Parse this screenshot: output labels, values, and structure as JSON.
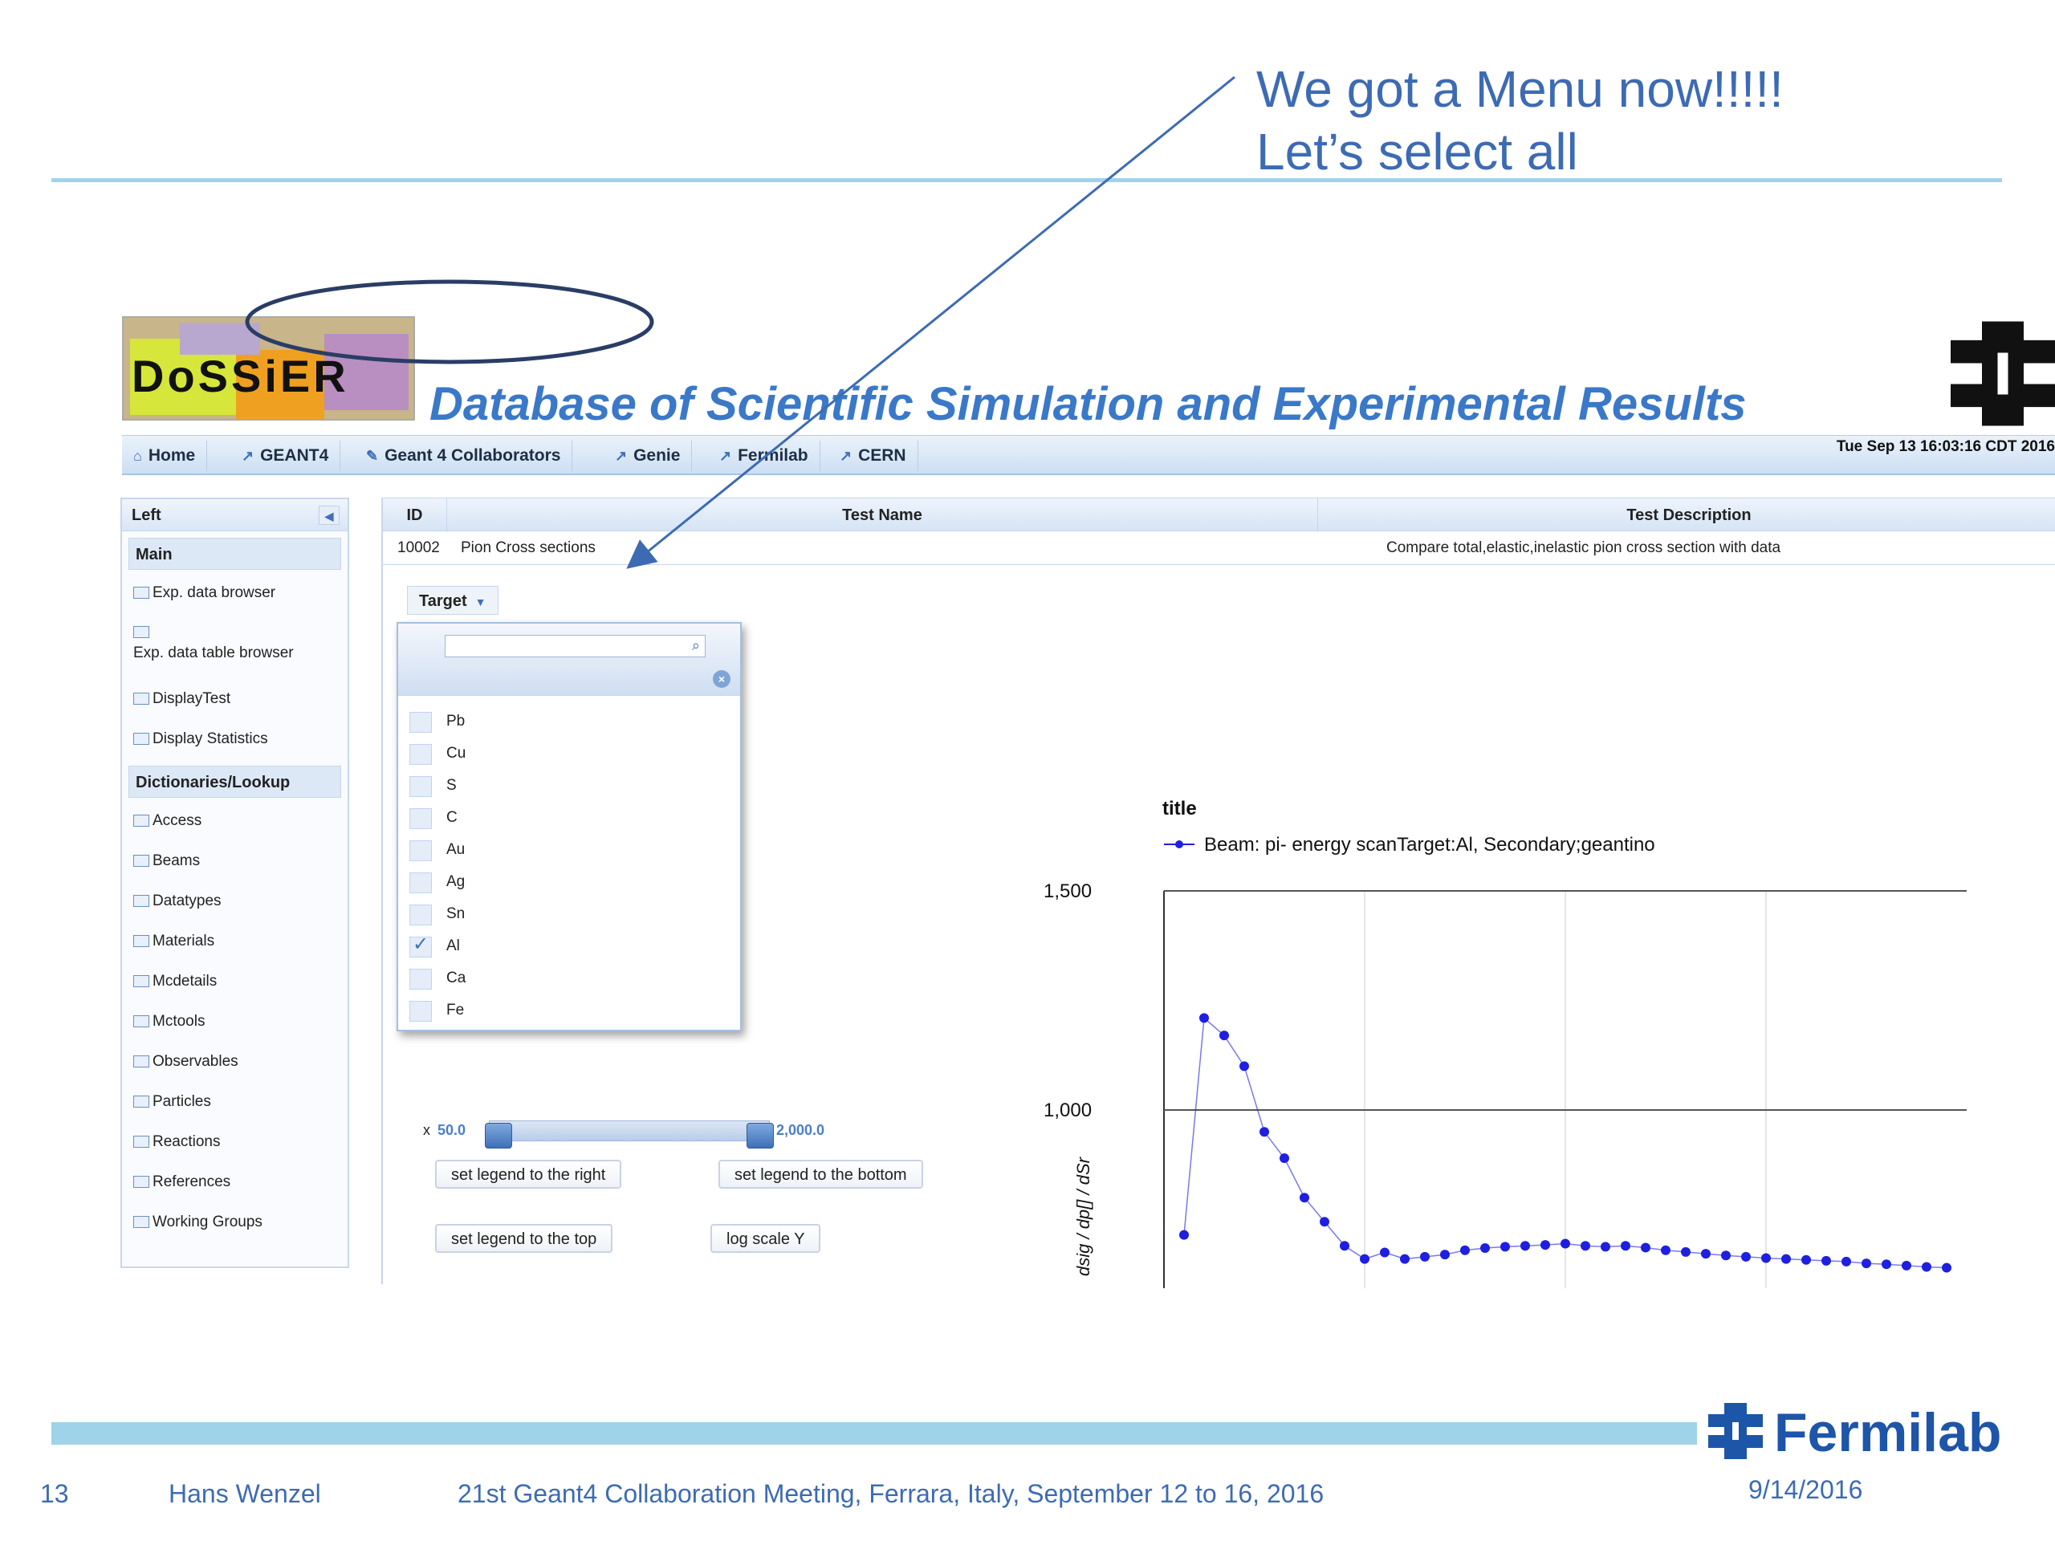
{
  "callout": {
    "line1": "We got a Menu now!!!!!",
    "line2": "Let’s select all"
  },
  "app": {
    "logo_text": "DoSSiER",
    "title": "Database of Scientific Simulation and Experimental Results",
    "datetime": "Tue Sep 13 16:03:16 CDT 2016",
    "nav": [
      {
        "label": "Home",
        "icon": "home-icon"
      },
      {
        "label": "GEANT4",
        "icon": "external-link-icon"
      },
      {
        "label": "Geant 4 Collaborators",
        "icon": "wrench-icon"
      },
      {
        "label": "Genie",
        "icon": "external-link-icon"
      },
      {
        "label": "Fermilab",
        "icon": "external-link-icon"
      },
      {
        "label": "CERN",
        "icon": "external-link-icon"
      }
    ],
    "left_panel": {
      "title": "Left",
      "sections": [
        {
          "title": "Main",
          "items": [
            "Exp. data browser",
            "Exp. data table browser",
            "DisplayTest",
            "Display Statistics"
          ]
        },
        {
          "title": "Dictionaries/Lookup",
          "items": [
            "Access",
            "Beams",
            "Datatypes",
            "Materials",
            "Mcdetails",
            "Mctools",
            "Observables",
            "Particles",
            "Reactions",
            "References",
            "Working Groups"
          ]
        }
      ]
    },
    "grid": {
      "headers": [
        "ID",
        "Test Name",
        "Test Description"
      ],
      "row": {
        "id": "10002",
        "name": "Pion Cross sections",
        "description": "Compare total,elastic,inelastic pion cross section with data"
      }
    },
    "target_label": "Target",
    "target_options": [
      {
        "label": "Pb",
        "checked": false
      },
      {
        "label": "Cu",
        "checked": false
      },
      {
        "label": "S",
        "checked": false
      },
      {
        "label": "C",
        "checked": false
      },
      {
        "label": "Au",
        "checked": false
      },
      {
        "label": "Ag",
        "checked": false
      },
      {
        "label": "Sn",
        "checked": false
      },
      {
        "label": "Al",
        "checked": true
      },
      {
        "label": "Ca",
        "checked": false
      },
      {
        "label": "Fe",
        "checked": false
      }
    ],
    "slider": {
      "axis": "x",
      "min_label": "50.0",
      "max_label": "2,000.0",
      "min": 50,
      "max": 2000
    },
    "buttons": {
      "legend_right": "set legend to the right",
      "legend_bottom": "set legend to the bottom",
      "legend_top": "set legend to the top",
      "log_scale": "log scale Y"
    }
  },
  "chart_data": {
    "type": "line",
    "title": "title",
    "legend": [
      "Beam: pi- energy scanTarget:Al, Secondary;geantino"
    ],
    "ylabel": "dsig / dp[] / dSr",
    "y_ticks": [
      "1,500",
      "1,000"
    ],
    "ylim": [
      600,
      1500
    ],
    "xlim": [
      0,
      4
    ],
    "color": "#1f1fe0",
    "series": [
      {
        "name": "Beam: pi- energy scanTarget:Al, Secondary;geantino",
        "x": [
          0.1,
          0.2,
          0.3,
          0.4,
          0.5,
          0.6,
          0.7,
          0.8,
          0.9,
          1.0,
          1.1,
          1.2,
          1.3,
          1.4,
          1.5,
          1.6,
          1.7,
          1.8,
          1.9,
          2.0,
          2.1,
          2.2,
          2.3,
          2.4,
          2.5,
          2.6,
          2.7,
          2.8,
          2.9,
          3.0,
          3.1,
          3.2,
          3.3,
          3.4,
          3.5,
          3.6,
          3.7,
          3.8,
          3.9
        ],
        "y": [
          715,
          1210,
          1170,
          1100,
          950,
          890,
          800,
          745,
          690,
          660,
          675,
          660,
          665,
          670,
          680,
          685,
          688,
          690,
          692,
          695,
          690,
          688,
          690,
          686,
          680,
          676,
          672,
          668,
          665,
          662,
          660,
          658,
          656,
          654,
          650,
          648,
          645,
          642,
          640
        ]
      }
    ]
  },
  "footer": {
    "page": "13",
    "author": "Hans Wenzel",
    "event": "21st Geant4 Collaboration Meeting, Ferrara, Italy, September 12 to 16, 2016",
    "date": "9/14/2016",
    "brand": "Fermilab"
  }
}
